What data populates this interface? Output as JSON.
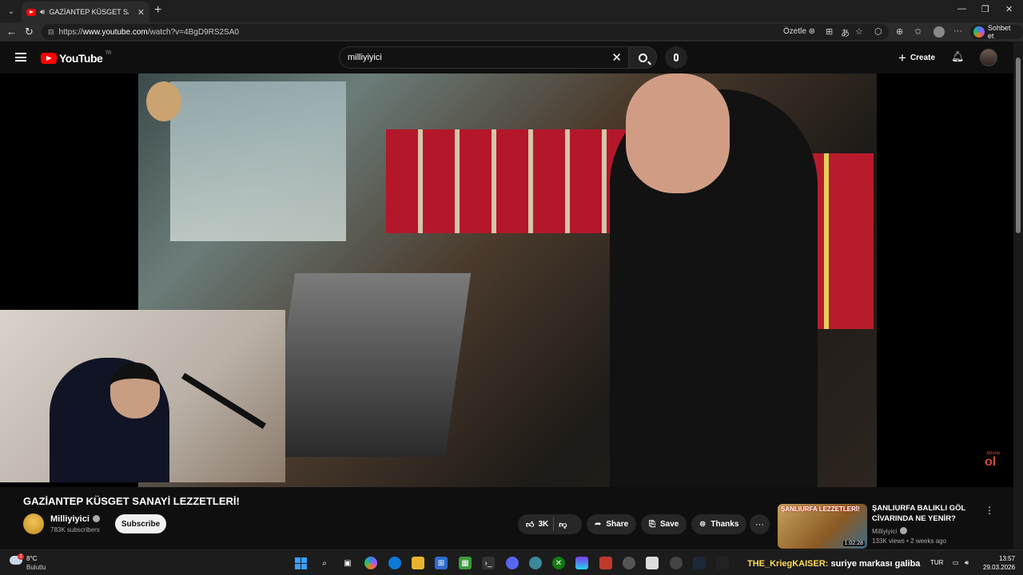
{
  "browser": {
    "tab_title": "GAZİANTEP KÜSGET SANAYİ LEZZETLERİ!",
    "url_prefix": "https://",
    "url_host": "www.youtube.com",
    "url_path": "/watch?v=4BgD9RS2SA0",
    "ozetle_label": "Özetle",
    "sohbet_label": "Sohbet et"
  },
  "youtube": {
    "logo_text": "YouTube",
    "country_code": "TR",
    "search_value": "milliyiyici",
    "create_label": "Create"
  },
  "video": {
    "title": "GAZİANTEP KÜSGET SANAYİ LEZZETLERİ!",
    "abone_small": "Abone",
    "abone_text": "ol"
  },
  "channel": {
    "name": "Milliyiyici",
    "subscribers": "783K subscribers",
    "subscribe_label": "Subscribe"
  },
  "actions": {
    "likes": "3K",
    "share_label": "Share",
    "save_label": "Save",
    "thanks_label": "Thanks"
  },
  "recommendation": {
    "thumb_text": "ŞANLIURFA LEZZETLERİ!",
    "duration": "1:02:28",
    "title": "ŞANLIURFA BALIKLI GÖL CİVARINDA NE YENİR?",
    "channel": "Milliyiyici",
    "meta": "133K views • 2 weeks ago"
  },
  "taskbar": {
    "temperature": "8°C",
    "weather_desc": "Bulutlu",
    "chat_user": "THE_KriegKAISER:",
    "chat_message": " suriye markası galiba",
    "language": "TUR",
    "time": "13:57",
    "date": "29.03.2026"
  },
  "colors": {
    "youtube_red": "#ff0000",
    "background": "#0f0f0f",
    "pill": "#272727"
  }
}
